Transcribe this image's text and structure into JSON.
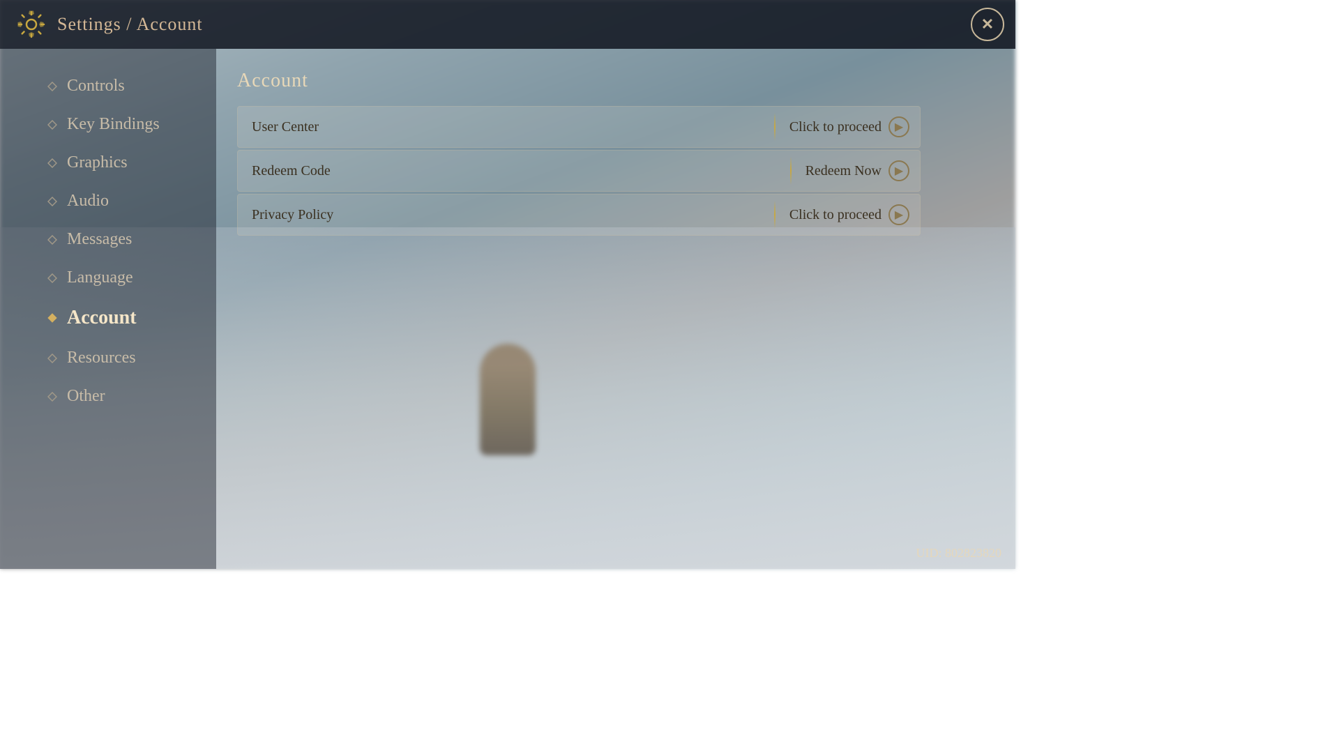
{
  "header": {
    "title": "Settings / Account",
    "close_label": "✕"
  },
  "sidebar": {
    "items": [
      {
        "id": "controls",
        "label": "Controls",
        "active": false
      },
      {
        "id": "key-bindings",
        "label": "Key Bindings",
        "active": false
      },
      {
        "id": "graphics",
        "label": "Graphics",
        "active": false
      },
      {
        "id": "audio",
        "label": "Audio",
        "active": false
      },
      {
        "id": "messages",
        "label": "Messages",
        "active": false
      },
      {
        "id": "language",
        "label": "Language",
        "active": false
      },
      {
        "id": "account",
        "label": "Account",
        "active": true
      },
      {
        "id": "resources",
        "label": "Resources",
        "active": false
      },
      {
        "id": "other",
        "label": "Other",
        "active": false
      }
    ]
  },
  "main": {
    "section_title": "Account",
    "options": [
      {
        "id": "user-center",
        "name": "User Center",
        "action": "Click to proceed"
      },
      {
        "id": "redeem-code",
        "name": "Redeem Code",
        "action": "Redeem Now"
      },
      {
        "id": "privacy-policy",
        "name": "Privacy Policy",
        "action": "Click to proceed"
      }
    ]
  },
  "footer": {
    "uid_label": "UID: 802823820"
  },
  "icons": {
    "gear": "⚙",
    "diamond_active": "◆",
    "diamond_normal": "◆",
    "arrow": "▶"
  }
}
